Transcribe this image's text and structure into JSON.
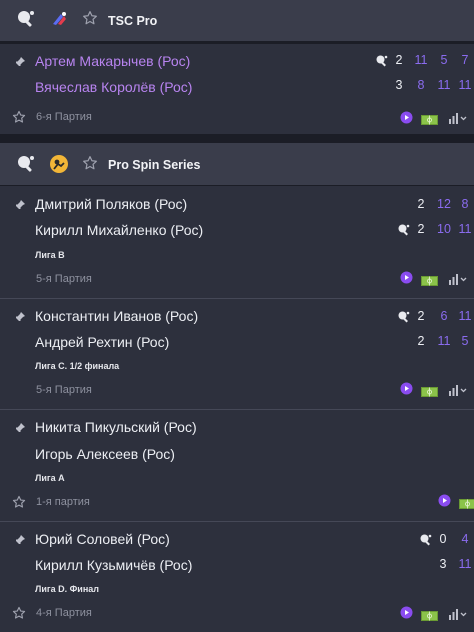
{
  "leagues": [
    {
      "name": "TSC Pro",
      "logo_icon": "tsc-pro-logo",
      "matches": [
        {
          "player1": "Артем Макарычев (Рос)",
          "player2": "Вячеслав Королёв (Рос)",
          "live_names": true,
          "serving": 1,
          "p1_sets": "2",
          "p1_scores": [
            "11",
            "5",
            "7"
          ],
          "p2_sets": "3",
          "p2_scores": [
            "8",
            "11",
            "11"
          ],
          "league_sub": "",
          "period": "6-я Партия"
        }
      ]
    },
    {
      "name": "Pro Spin Series",
      "logo_icon": "pro-spin-logo",
      "matches": [
        {
          "player1": "Дмитрий Поляков (Рос)",
          "player2": "Кирилл Михайленко (Рос)",
          "live_names": false,
          "serving": 2,
          "p1_sets": "2",
          "p1_scores": [
            "12",
            "8"
          ],
          "p2_sets": "2",
          "p2_scores": [
            "10",
            "11"
          ],
          "league_sub": "Лига B",
          "period": "5-я Партия"
        },
        {
          "player1": "Константин Иванов (Рос)",
          "player2": "Андрей Рехтин (Рос)",
          "live_names": false,
          "serving": 1,
          "p1_sets": "2",
          "p1_scores": [
            "6",
            "11"
          ],
          "p2_sets": "2",
          "p2_scores": [
            "11",
            "5"
          ],
          "league_sub": "Лига C. 1/2 финала",
          "period": "5-я Партия"
        },
        {
          "player1": "Никита Пикульский (Рос)",
          "player2": "Игорь Алексеев (Рос)",
          "live_names": false,
          "serving": 0,
          "league_sub": "Лига A",
          "period": "1-я партия"
        },
        {
          "player1": "Юрий Соловей (Рос)",
          "player2": "Кирилл Кузьмичёв (Рос)",
          "live_names": false,
          "serving": 1,
          "p1_sets": "0",
          "p1_scores": [
            "4"
          ],
          "p2_sets": "3",
          "p2_scores": [
            "11"
          ],
          "league_sub": "Лига D. Финал",
          "period": "4-я Партия"
        }
      ]
    }
  ],
  "icons": {
    "sport": "table-tennis-icon",
    "favorite": "star-outline-icon",
    "pin": "pin-icon",
    "serve": "serve-ball-icon",
    "video": "play-video-icon",
    "field": "match-field-icon",
    "stats": "stats-chart-icon"
  },
  "colors": {
    "header_bg": "#3a3d4b",
    "card_bg": "#2d303d",
    "page_bg": "#1b1d26",
    "accent_purple": "#8b6cf0",
    "live_name_purple": "#b884f0",
    "field_green": "#8bc34a",
    "muted_text": "#8e919f"
  }
}
